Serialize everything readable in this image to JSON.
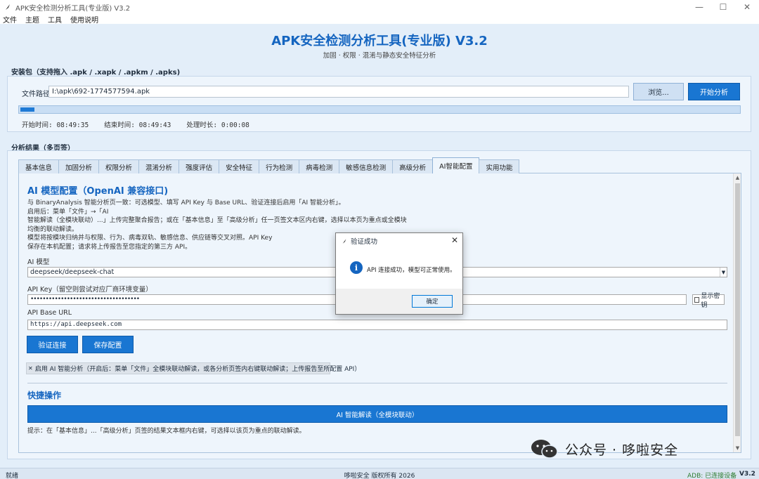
{
  "window": {
    "title": "APK安全检测分析工具(专业版) V3.2",
    "controls": [
      "—",
      "☐",
      "✕"
    ]
  },
  "menu": [
    "文件",
    "主题",
    "工具",
    "使用说明"
  ],
  "header": {
    "title": "APK安全检测分析工具(专业版)  V3.2",
    "subtitle": "加固 · 权限 · 混淆与静态安全特征分析"
  },
  "install": {
    "group_label": "安装包（支持拖入 .apk / .xapk / .apkm / .apks)",
    "file_label": "文件路径",
    "file_path": "I:\\apk\\692-1774577594.apk",
    "browse_label": "浏览...",
    "start_label": "开始分析",
    "progress": 0.02,
    "start_time": "开始时间: 08:49:35",
    "end_time": "结束时间: 08:49:43",
    "duration": "处理时长: 0:00:08"
  },
  "results": {
    "group_label": "分析结果（多页签）",
    "tabs": [
      "基本信息",
      "加固分析",
      "权限分析",
      "混淆分析",
      "强度评估",
      "安全特征",
      "行为检测",
      "病毒检测",
      "敏感信息检测",
      "高级分析",
      "AI智能配置",
      "实用功能"
    ],
    "active_tab": 10
  },
  "ai": {
    "title": "AI 模型配置（OpenAI 兼容接口)",
    "desc_lines": [
      "与 BinaryAnalysis 智能分析页一致：可选模型、填写 API Key 与 Base URL、验证连接后启用「AI 智能分析」。",
      "启用后：菜单「文件」→「AI",
      "智能解读（全模块联动）...」上传完整聚合报告；或在「基本信息」至「高级分析」任一页签文本区内右键，选择以本页为重点或全模块",
      "均衡的联动解读。",
      "模型将按模块归纳并与权限、行为、病毒双轨、敏感信息、供应链等交叉对照。API Key",
      "保存在本机配置；请求将上传报告至您指定的第三方 API。"
    ],
    "model_label": "AI 模型",
    "model_value": "deepseek/deepseek-chat",
    "key_label": "API Key（留空则尝试对应厂商环境变量）",
    "key_value": "••••••••••••••••••••••••••••••••••••",
    "show_key_label": "显示密钥",
    "url_label": "API Base URL",
    "url_value": "https://api.deepseek.com",
    "verify_label": "验证连接",
    "save_label": "保存配置",
    "enable_label": "启用 AI 智能分析（开启后：菜单「文件」全模块联动解读，或各分析页签内右键联动解读；上传报告至所配置 API）",
    "quick_title": "快捷操作",
    "quick_button": "AI 智能解读（全模块联动）",
    "tip": "提示：在「基本信息」...「高级分析」页签的结果文本框内右键，可选择以该页为重点的联动解读。"
  },
  "dialog": {
    "title": "验证成功",
    "message": "API 连接成功，模型可正常使用。",
    "ok_label": "确定"
  },
  "status": {
    "left": "就绪",
    "center": "哆啦安全 版权所有 2026",
    "adb": "ADB: 已连接设备",
    "version": "V3.2"
  },
  "watermark": {
    "text": "公众号 · 哆啦安全"
  },
  "colors": {
    "accent": "#1976d2",
    "title_blue": "#1565c0",
    "background": "#e3eef9",
    "adb_green": "#2e7d32"
  }
}
